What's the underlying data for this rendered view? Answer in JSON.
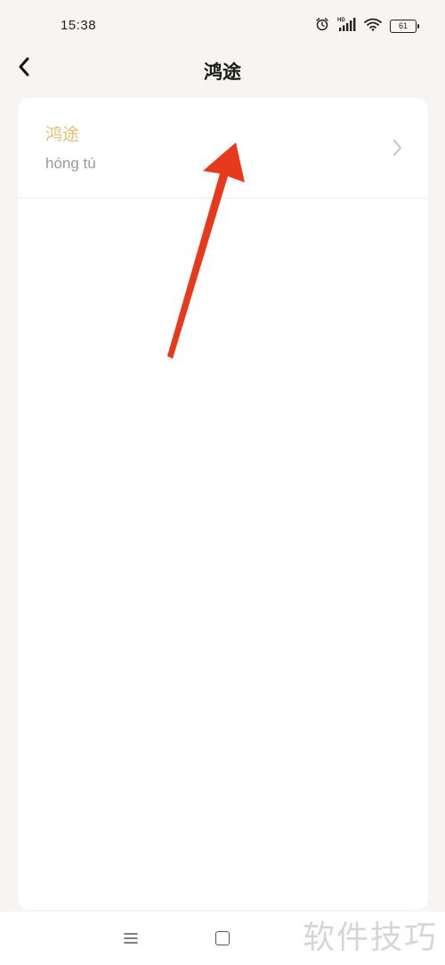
{
  "status_bar": {
    "time": "15:38",
    "battery_level": "61",
    "icons": [
      "alarm-icon",
      "hd-signal-icon",
      "wifi-icon",
      "battery-icon"
    ]
  },
  "header": {
    "title": "鸿途",
    "back_icon": "chevron-left-icon"
  },
  "results": [
    {
      "word": "鸿途",
      "pinyin": "hóng tú",
      "chevron_icon": "chevron-right-icon"
    }
  ],
  "navigation": {
    "menu_icon": "menu-icon",
    "home_icon": "home-square-icon"
  },
  "watermark": "软件技巧",
  "colors": {
    "background": "#f6f5f3",
    "card": "#ffffff",
    "word_accent": "#e2c276",
    "pinyin": "#9a9a9a",
    "annotation_arrow": "#e8391d"
  }
}
